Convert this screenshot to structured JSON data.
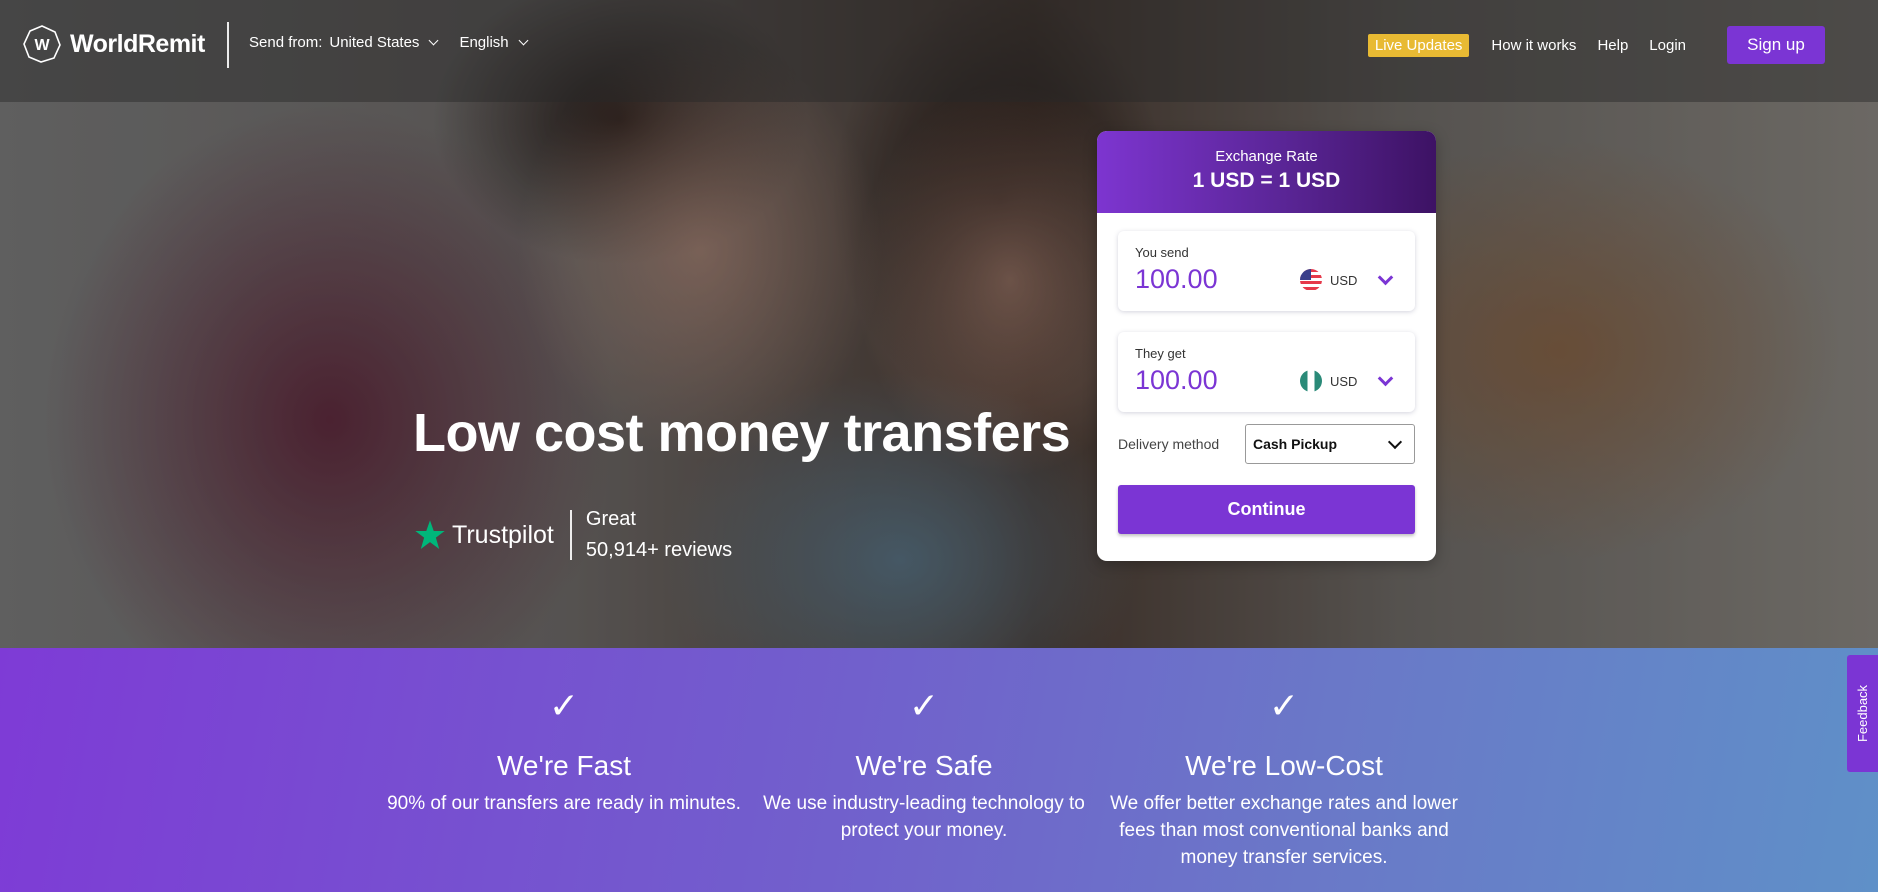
{
  "header": {
    "brand": "WorldRemit",
    "send_from_label": "Send from:",
    "send_from_value": "United States",
    "language": "English",
    "live_updates": "Live Updates",
    "links": [
      "How it works",
      "Help",
      "Login"
    ],
    "signup": "Sign up"
  },
  "hero": {
    "title": "Low cost money transfers",
    "trustpilot": {
      "name": "Trustpilot",
      "rating": "Great",
      "reviews": "50,914+ reviews"
    }
  },
  "calculator": {
    "exchange_rate_label": "Exchange Rate",
    "exchange_rate_value": "1 USD = 1 USD",
    "send": {
      "label": "You send",
      "amount": "100.00",
      "currency": "USD",
      "flag": "us-flag"
    },
    "get": {
      "label": "They get",
      "amount": "100.00",
      "currency": "USD",
      "flag": "ng-flag"
    },
    "delivery_label": "Delivery method",
    "delivery_value": "Cash Pickup",
    "continue": "Continue"
  },
  "features": [
    {
      "icon": "check-icon",
      "title": "We're Fast",
      "desc": "90% of our transfers are ready in minutes."
    },
    {
      "icon": "check-icon",
      "title": "We're Safe",
      "desc": "We use industry-leading technology to protect your money."
    },
    {
      "icon": "check-icon",
      "title": "We're Low-Cost",
      "desc": "We offer better exchange rates and lower fees than most conventional banks and money transfer services."
    }
  ],
  "feedback": "Feedback",
  "colors": {
    "brand_purple": "#7b35d4",
    "live_badge": "#e8ba33",
    "trustpilot_green": "#00b67a"
  }
}
